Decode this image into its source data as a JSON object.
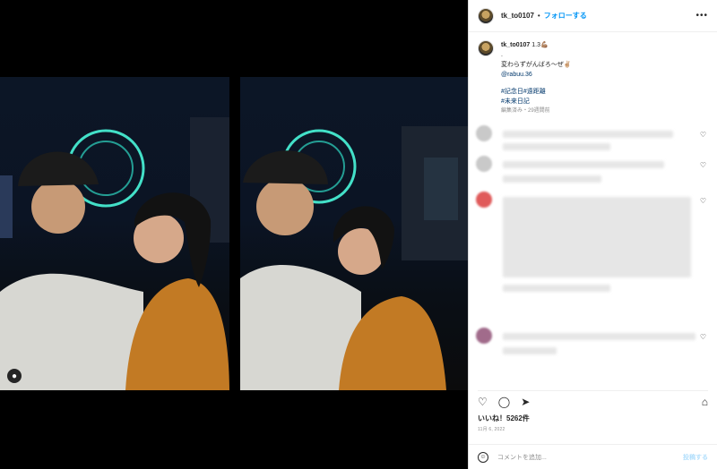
{
  "header": {
    "username": "tk_to0107",
    "separator": "•",
    "follow_label": "フォローする",
    "more_icon": "more-horizontal-icon"
  },
  "caption": {
    "username": "tk_to0107",
    "text_line1": "1.3💪🏽",
    "text_line2": ".",
    "text_line3": "変わらずがんばろ〜ぜ✌🏼",
    "mention": "@rabuu.36",
    "hashtags_line1": "#記念日#遠距離",
    "hashtags_line2": "#未来日記",
    "meta": "編集済み・29週間前"
  },
  "actions": {
    "like_icon": "heart-icon",
    "comment_icon": "comment-icon",
    "share_icon": "send-icon",
    "save_icon": "bookmark-icon"
  },
  "stats": {
    "likes": "いいね！5262件",
    "date": "11月 6, 2022"
  },
  "add_comment": {
    "emoji_icon": "smile-icon",
    "placeholder": "コメントを追加...",
    "post_label": "投稿する"
  },
  "colors": {
    "accent": "#0095f6",
    "text": "#262626",
    "muted": "#8e8e8e",
    "link": "#00376b",
    "border": "#dbdbdb"
  }
}
